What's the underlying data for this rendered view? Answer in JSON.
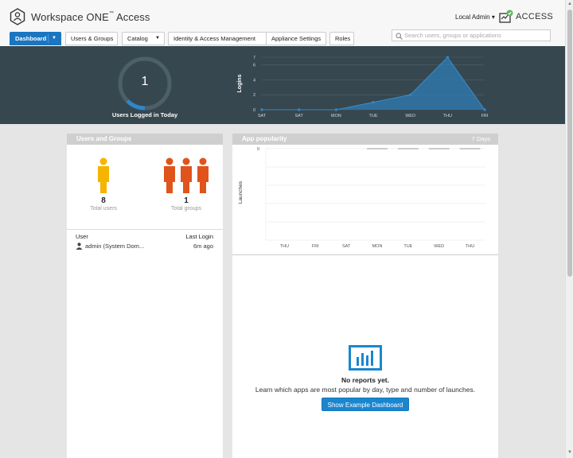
{
  "header": {
    "title": "Workspace ONE",
    "title_tm": "™",
    "title_suffix": " Access",
    "user_menu": "Local Admin",
    "product_label": "ACCESS"
  },
  "tabs": [
    {
      "label": "Dashboard",
      "active": true,
      "dropdown": true
    },
    {
      "label": "Users & Groups",
      "active": false,
      "dropdown": false
    },
    {
      "label": "Catalog",
      "active": false,
      "dropdown": true
    },
    {
      "label": "Identity & Access Management",
      "active": false,
      "dropdown": false
    },
    {
      "label": "Appliance Settings",
      "active": false,
      "dropdown": false
    },
    {
      "label": "Roles",
      "active": false,
      "dropdown": false
    }
  ],
  "search": {
    "placeholder": "Search users, groups or applications"
  },
  "banner": {
    "logged_in_count": "1",
    "logged_in_label": "Users Logged in Today",
    "logged_in_fraction": 0.125
  },
  "chart_data": [
    {
      "type": "area",
      "ylabel": "Logins",
      "categories": [
        "SAT",
        "SAT",
        "MON",
        "TUE",
        "WED",
        "THU",
        "FRI"
      ],
      "yticks": [
        0,
        2,
        4,
        6,
        7
      ],
      "ylim": [
        0,
        7
      ],
      "series": [
        {
          "values": [
            0,
            0,
            0,
            1,
            2,
            7,
            0
          ]
        }
      ],
      "grid": true
    },
    {
      "type": "bar",
      "title": "App popularity",
      "range_label": "7 Days",
      "ylabel": "Launches",
      "categories": [
        "THU",
        "FRI",
        "SAT",
        "MON",
        "TUE",
        "WED",
        "THU"
      ],
      "yticks": [
        0
      ],
      "series": [
        {
          "values": [
            0,
            0,
            0,
            0,
            0,
            0,
            0
          ]
        }
      ],
      "grid": true
    }
  ],
  "users_panel": {
    "title": "Users and Groups",
    "total_users": "8",
    "total_users_label": "Total users",
    "total_groups": "1",
    "total_groups_label": "Total groups",
    "col_user": "User",
    "col_last_login": "Last Login",
    "rows": [
      {
        "user": "admin (System Dom...",
        "last_login": "6m ago"
      }
    ]
  },
  "apps_panel": {
    "no_reports": "No reports yet.",
    "learn_text": "Learn which apps are most popular by day, type and number of launches.",
    "example_button": "Show Example Dashboard"
  },
  "colors": {
    "primary": "#1a76c2",
    "banner": "#37474f",
    "users_icon": "#f5b400",
    "groups_icon": "#e0541c",
    "chart_area": "#2f7cb5"
  }
}
